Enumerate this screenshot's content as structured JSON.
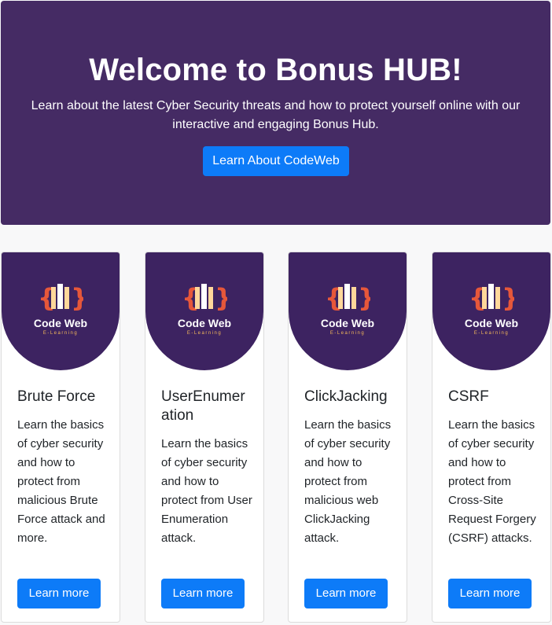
{
  "hero": {
    "title": "Welcome to Bonus HUB!",
    "text": "Learn about the latest Cyber Security threats and how to protect yourself online with our interactive and engaging Bonus Hub.",
    "button": "Learn About CodeWeb"
  },
  "logo": {
    "name": "Code Web",
    "tagline": "E-Learning"
  },
  "cards": [
    {
      "title": "Brute Force",
      "text": "Learn the basics of cyber security and how to protect from malicious Brute Force attack and more.",
      "button": "Learn more"
    },
    {
      "title": "UserEnumeration",
      "text": "Learn the basics of cyber security and how to protect from User Enumeration attack.",
      "button": "Learn more"
    },
    {
      "title": "ClickJacking",
      "text": "Learn the basics of cyber security and how to protect from malicious web ClickJacking attack.",
      "button": "Learn more"
    },
    {
      "title": "CSRF",
      "text": "Learn the basics of cyber security and how to protect from Cross-Site Request Forgery (CSRF) attacks.",
      "button": "Learn more"
    }
  ],
  "colors": {
    "hero_bg": "#452b64",
    "card_banner": "#3d2361",
    "accent": "#0d7bf8"
  }
}
